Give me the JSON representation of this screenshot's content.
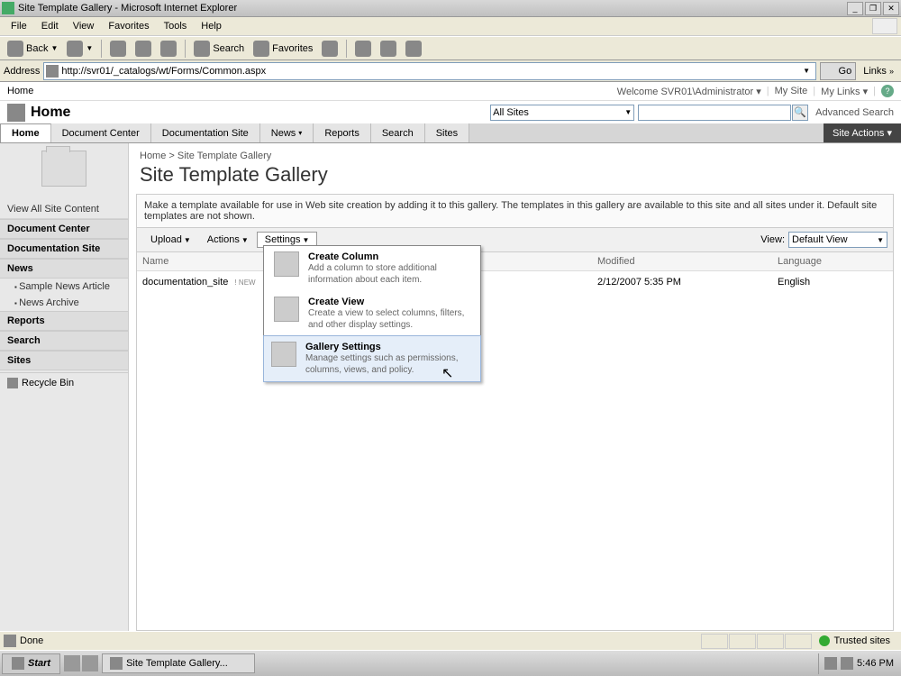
{
  "window": {
    "title": "Site Template Gallery - Microsoft Internet Explorer"
  },
  "menubar": {
    "file": "File",
    "edit": "Edit",
    "view": "View",
    "favorites": "Favorites",
    "tools": "Tools",
    "help": "Help"
  },
  "toolbar": {
    "back": "Back",
    "search": "Search",
    "favorites": "Favorites"
  },
  "addressbar": {
    "label": "Address",
    "url": "http://svr01/_catalogs/wt/Forms/Common.aspx",
    "go": "Go",
    "links": "Links"
  },
  "sp_top": {
    "home": "Home",
    "welcome": "Welcome SVR01\\Administrator ▾",
    "mysite": "My Site",
    "mylinks": "My Links ▾"
  },
  "sp_header": {
    "title": "Home",
    "scope": "All Sites",
    "adv_search": "Advanced Search"
  },
  "nav_tabs": {
    "items": [
      {
        "label": "Home",
        "active": true
      },
      {
        "label": "Document Center"
      },
      {
        "label": "Documentation Site"
      },
      {
        "label": "News",
        "dropdown": true
      },
      {
        "label": "Reports"
      },
      {
        "label": "Search"
      },
      {
        "label": "Sites"
      }
    ],
    "site_actions": "Site Actions ▾"
  },
  "leftnav": {
    "view_all": "View All Site Content",
    "doc_center": "Document Center",
    "doc_site": "Documentation Site",
    "news": "News",
    "news_sub1": "Sample News Article",
    "news_sub2": "News Archive",
    "reports": "Reports",
    "search": "Search",
    "sites": "Sites",
    "recycle": "Recycle Bin"
  },
  "main": {
    "breadcrumb_home": "Home",
    "breadcrumb_sep": " > ",
    "breadcrumb_current": "Site Template Gallery",
    "page_title": "Site Template Gallery",
    "description": "Make a template available for use in Web site creation by adding it to this gallery. The templates in this gallery are available to this site and all sites under it. Default site templates are not shown.",
    "tb_upload": "Upload",
    "tb_actions": "Actions",
    "tb_settings": "Settings",
    "view_label": "View:",
    "view_value": "Default View"
  },
  "table": {
    "col_name": "Name",
    "col_modified": "Modified",
    "col_language": "Language",
    "rows": [
      {
        "name": "documentation_site",
        "new": "! NEW",
        "modified": "2/12/2007 5:35 PM",
        "language": "English"
      }
    ]
  },
  "dropdown": {
    "items": [
      {
        "title": "Create Column",
        "desc": "Add a column to store additional information about each item."
      },
      {
        "title": "Create View",
        "desc": "Create a view to select columns, filters, and other display settings."
      },
      {
        "title": "Gallery Settings",
        "desc": "Manage settings such as permissions, columns, views, and policy.",
        "hover": true
      }
    ]
  },
  "statusbar": {
    "text": "Done",
    "zone": "Trusted sites"
  },
  "taskbar": {
    "start": "Start",
    "task1": "Site Template Gallery...",
    "clock": "5:46 PM"
  }
}
